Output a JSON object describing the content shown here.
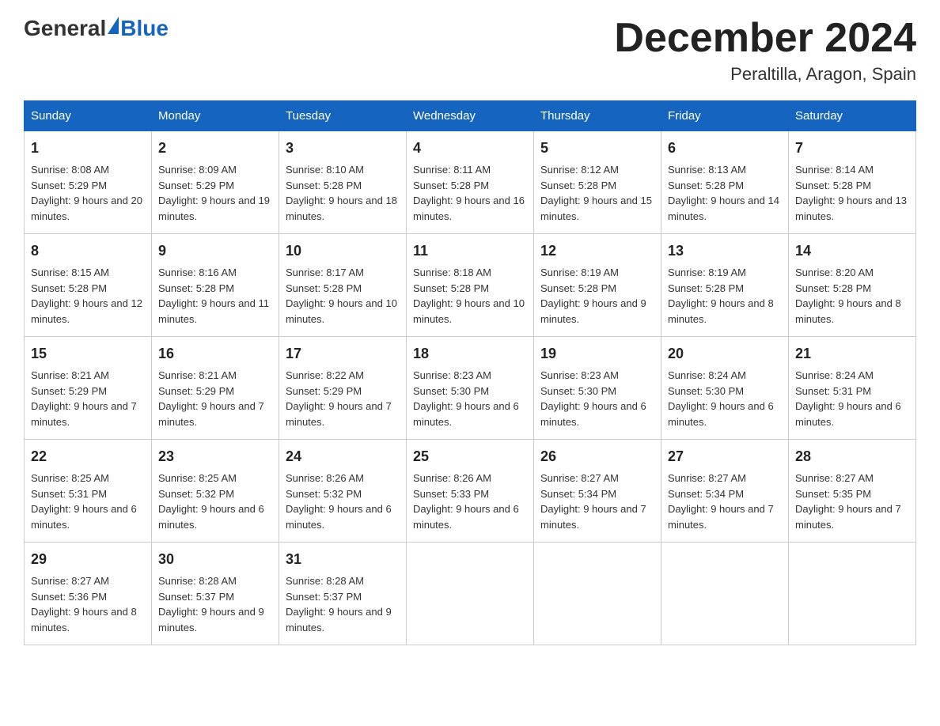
{
  "header": {
    "logo_general": "General",
    "logo_blue": "Blue",
    "title": "December 2024",
    "subtitle": "Peraltilla, Aragon, Spain"
  },
  "days_of_week": [
    "Sunday",
    "Monday",
    "Tuesday",
    "Wednesday",
    "Thursday",
    "Friday",
    "Saturday"
  ],
  "weeks": [
    [
      {
        "day": "1",
        "sunrise": "Sunrise: 8:08 AM",
        "sunset": "Sunset: 5:29 PM",
        "daylight": "Daylight: 9 hours and 20 minutes."
      },
      {
        "day": "2",
        "sunrise": "Sunrise: 8:09 AM",
        "sunset": "Sunset: 5:29 PM",
        "daylight": "Daylight: 9 hours and 19 minutes."
      },
      {
        "day": "3",
        "sunrise": "Sunrise: 8:10 AM",
        "sunset": "Sunset: 5:28 PM",
        "daylight": "Daylight: 9 hours and 18 minutes."
      },
      {
        "day": "4",
        "sunrise": "Sunrise: 8:11 AM",
        "sunset": "Sunset: 5:28 PM",
        "daylight": "Daylight: 9 hours and 16 minutes."
      },
      {
        "day": "5",
        "sunrise": "Sunrise: 8:12 AM",
        "sunset": "Sunset: 5:28 PM",
        "daylight": "Daylight: 9 hours and 15 minutes."
      },
      {
        "day": "6",
        "sunrise": "Sunrise: 8:13 AM",
        "sunset": "Sunset: 5:28 PM",
        "daylight": "Daylight: 9 hours and 14 minutes."
      },
      {
        "day": "7",
        "sunrise": "Sunrise: 8:14 AM",
        "sunset": "Sunset: 5:28 PM",
        "daylight": "Daylight: 9 hours and 13 minutes."
      }
    ],
    [
      {
        "day": "8",
        "sunrise": "Sunrise: 8:15 AM",
        "sunset": "Sunset: 5:28 PM",
        "daylight": "Daylight: 9 hours and 12 minutes."
      },
      {
        "day": "9",
        "sunrise": "Sunrise: 8:16 AM",
        "sunset": "Sunset: 5:28 PM",
        "daylight": "Daylight: 9 hours and 11 minutes."
      },
      {
        "day": "10",
        "sunrise": "Sunrise: 8:17 AM",
        "sunset": "Sunset: 5:28 PM",
        "daylight": "Daylight: 9 hours and 10 minutes."
      },
      {
        "day": "11",
        "sunrise": "Sunrise: 8:18 AM",
        "sunset": "Sunset: 5:28 PM",
        "daylight": "Daylight: 9 hours and 10 minutes."
      },
      {
        "day": "12",
        "sunrise": "Sunrise: 8:19 AM",
        "sunset": "Sunset: 5:28 PM",
        "daylight": "Daylight: 9 hours and 9 minutes."
      },
      {
        "day": "13",
        "sunrise": "Sunrise: 8:19 AM",
        "sunset": "Sunset: 5:28 PM",
        "daylight": "Daylight: 9 hours and 8 minutes."
      },
      {
        "day": "14",
        "sunrise": "Sunrise: 8:20 AM",
        "sunset": "Sunset: 5:28 PM",
        "daylight": "Daylight: 9 hours and 8 minutes."
      }
    ],
    [
      {
        "day": "15",
        "sunrise": "Sunrise: 8:21 AM",
        "sunset": "Sunset: 5:29 PM",
        "daylight": "Daylight: 9 hours and 7 minutes."
      },
      {
        "day": "16",
        "sunrise": "Sunrise: 8:21 AM",
        "sunset": "Sunset: 5:29 PM",
        "daylight": "Daylight: 9 hours and 7 minutes."
      },
      {
        "day": "17",
        "sunrise": "Sunrise: 8:22 AM",
        "sunset": "Sunset: 5:29 PM",
        "daylight": "Daylight: 9 hours and 7 minutes."
      },
      {
        "day": "18",
        "sunrise": "Sunrise: 8:23 AM",
        "sunset": "Sunset: 5:30 PM",
        "daylight": "Daylight: 9 hours and 6 minutes."
      },
      {
        "day": "19",
        "sunrise": "Sunrise: 8:23 AM",
        "sunset": "Sunset: 5:30 PM",
        "daylight": "Daylight: 9 hours and 6 minutes."
      },
      {
        "day": "20",
        "sunrise": "Sunrise: 8:24 AM",
        "sunset": "Sunset: 5:30 PM",
        "daylight": "Daylight: 9 hours and 6 minutes."
      },
      {
        "day": "21",
        "sunrise": "Sunrise: 8:24 AM",
        "sunset": "Sunset: 5:31 PM",
        "daylight": "Daylight: 9 hours and 6 minutes."
      }
    ],
    [
      {
        "day": "22",
        "sunrise": "Sunrise: 8:25 AM",
        "sunset": "Sunset: 5:31 PM",
        "daylight": "Daylight: 9 hours and 6 minutes."
      },
      {
        "day": "23",
        "sunrise": "Sunrise: 8:25 AM",
        "sunset": "Sunset: 5:32 PM",
        "daylight": "Daylight: 9 hours and 6 minutes."
      },
      {
        "day": "24",
        "sunrise": "Sunrise: 8:26 AM",
        "sunset": "Sunset: 5:32 PM",
        "daylight": "Daylight: 9 hours and 6 minutes."
      },
      {
        "day": "25",
        "sunrise": "Sunrise: 8:26 AM",
        "sunset": "Sunset: 5:33 PM",
        "daylight": "Daylight: 9 hours and 6 minutes."
      },
      {
        "day": "26",
        "sunrise": "Sunrise: 8:27 AM",
        "sunset": "Sunset: 5:34 PM",
        "daylight": "Daylight: 9 hours and 7 minutes."
      },
      {
        "day": "27",
        "sunrise": "Sunrise: 8:27 AM",
        "sunset": "Sunset: 5:34 PM",
        "daylight": "Daylight: 9 hours and 7 minutes."
      },
      {
        "day": "28",
        "sunrise": "Sunrise: 8:27 AM",
        "sunset": "Sunset: 5:35 PM",
        "daylight": "Daylight: 9 hours and 7 minutes."
      }
    ],
    [
      {
        "day": "29",
        "sunrise": "Sunrise: 8:27 AM",
        "sunset": "Sunset: 5:36 PM",
        "daylight": "Daylight: 9 hours and 8 minutes."
      },
      {
        "day": "30",
        "sunrise": "Sunrise: 8:28 AM",
        "sunset": "Sunset: 5:37 PM",
        "daylight": "Daylight: 9 hours and 9 minutes."
      },
      {
        "day": "31",
        "sunrise": "Sunrise: 8:28 AM",
        "sunset": "Sunset: 5:37 PM",
        "daylight": "Daylight: 9 hours and 9 minutes."
      },
      {
        "day": "",
        "sunrise": "",
        "sunset": "",
        "daylight": ""
      },
      {
        "day": "",
        "sunrise": "",
        "sunset": "",
        "daylight": ""
      },
      {
        "day": "",
        "sunrise": "",
        "sunset": "",
        "daylight": ""
      },
      {
        "day": "",
        "sunrise": "",
        "sunset": "",
        "daylight": ""
      }
    ]
  ]
}
